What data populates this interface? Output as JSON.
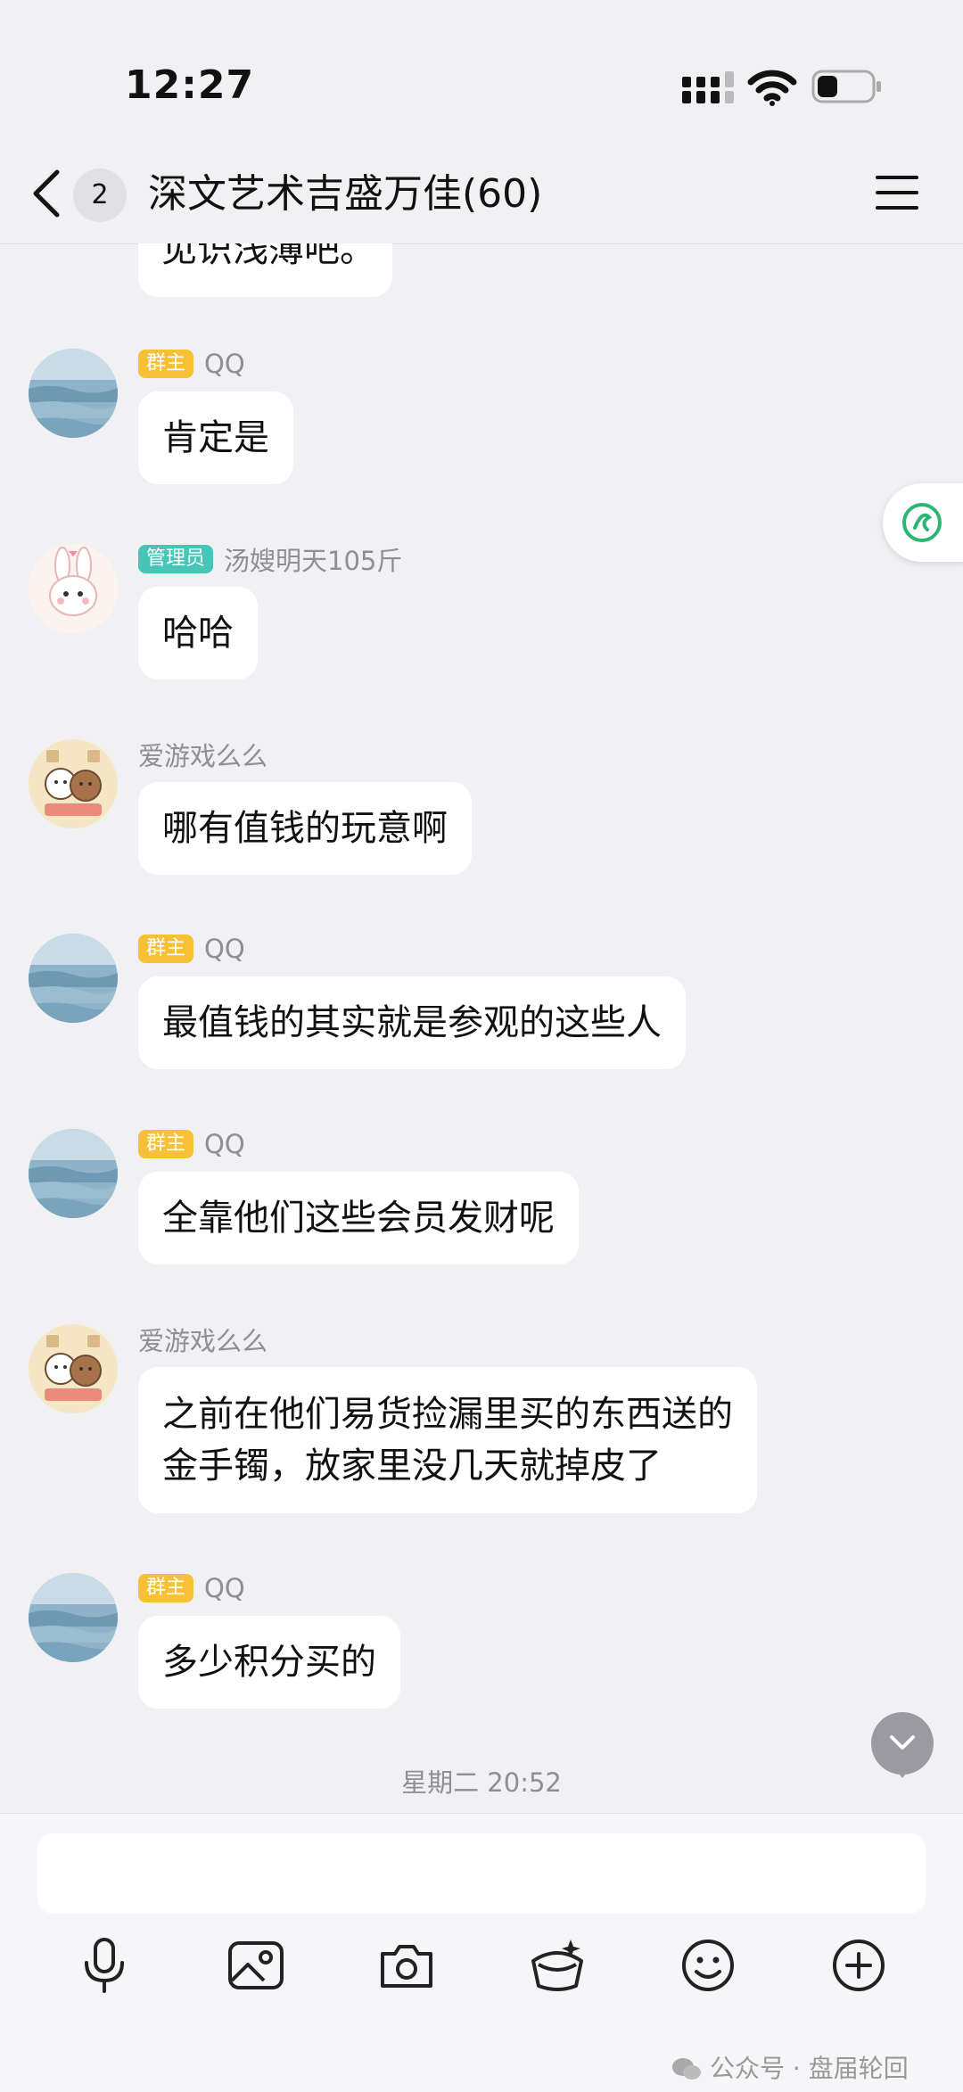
{
  "status_bar": {
    "time": "12:27"
  },
  "nav": {
    "unread_count": "2",
    "title": "深文艺术吉盛万佳(60)"
  },
  "messages": [
    {
      "role": "群主",
      "sender": "QQ",
      "lines": [
        "肯定是"
      ]
    },
    {
      "role": "管理员",
      "sender": "汤嫂明天105斤",
      "lines": [
        "哈哈"
      ]
    },
    {
      "role": "",
      "sender": "爱游戏么么",
      "lines": [
        "哪有值钱的玩意啊"
      ]
    },
    {
      "role": "群主",
      "sender": "QQ",
      "lines": [
        "最值钱的其实就是参观的这些人"
      ]
    },
    {
      "role": "群主",
      "sender": "QQ",
      "lines": [
        "全靠他们这些会员发财呢"
      ]
    },
    {
      "role": "",
      "sender": "爱游戏么么",
      "lines": [
        "之前在他们易货捡漏里买的东西送的",
        "金手镯，放家里没几天就掉皮了"
      ]
    },
    {
      "role": "群主",
      "sender": "QQ",
      "lines": [
        "多少积分买的"
      ]
    }
  ],
  "partial_message": "见识浅薄吧。",
  "timestamp": "星期二 20:52",
  "input": {
    "value": "",
    "placeholder": ""
  },
  "watermark": "公众号 · 盘届轮回",
  "colors": {
    "owner_badge": "#f6c136",
    "admin_badge": "#45c6b7",
    "background": "#f1f1f3"
  },
  "toolbar_icons": [
    "microphone-icon",
    "image-icon",
    "camera-icon",
    "red-packet-icon",
    "emoji-icon",
    "plus-icon"
  ]
}
